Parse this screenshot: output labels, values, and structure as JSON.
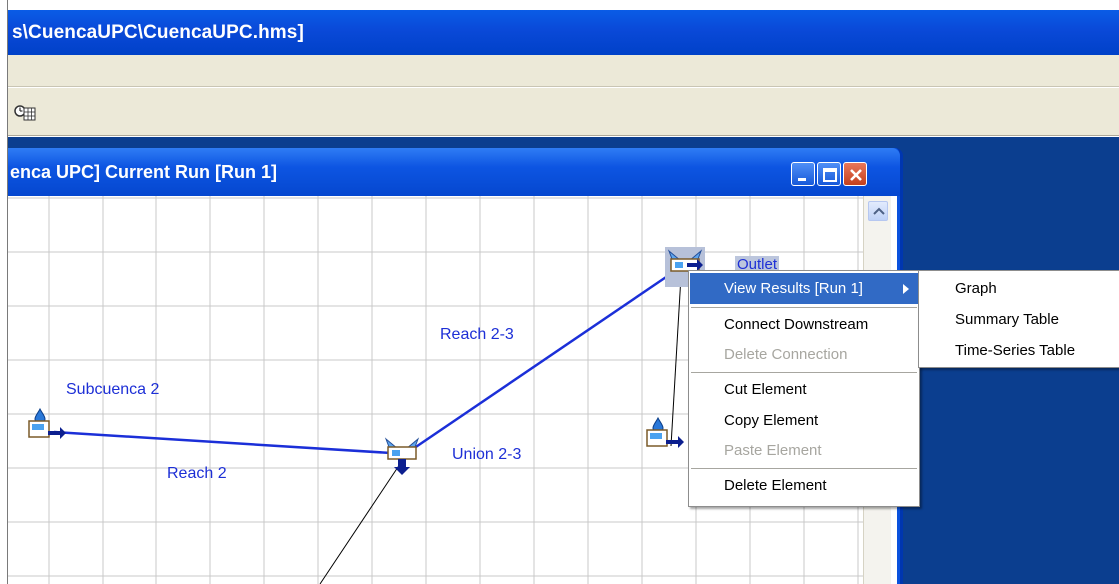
{
  "app": {
    "title": "s\\CuencaUPC\\CuencaUPC.hms]"
  },
  "child_window": {
    "title": "enca UPC]  Current Run [Run 1]"
  },
  "canvas": {
    "labels": {
      "subcuenca2": "Subcuenca 2",
      "reach2": "Reach 2",
      "reach23": "Reach 2-3",
      "union23": "Union 2-3",
      "outlet": "Outlet"
    }
  },
  "context_menu": {
    "items": [
      {
        "label": "View Results [Run 1]",
        "state": "highlighted",
        "has_submenu": true
      },
      {
        "label": "Connect Downstream",
        "state": "enabled"
      },
      {
        "label": "Delete Connection",
        "state": "disabled"
      },
      {
        "label": "Cut Element",
        "state": "enabled"
      },
      {
        "label": "Copy Element",
        "state": "enabled"
      },
      {
        "label": "Paste Element",
        "state": "disabled"
      },
      {
        "label": "Delete Element",
        "state": "enabled"
      }
    ]
  },
  "submenu": {
    "items": [
      {
        "label": "Graph"
      },
      {
        "label": "Summary Table"
      },
      {
        "label": "Time-Series Table"
      }
    ]
  },
  "colors": {
    "titlebar_blue": "#0a49d8",
    "menu_highlight": "#316ac5",
    "canvas_text": "#1d2fd6",
    "workspace": "#0b3e8f"
  },
  "icons": [
    "toolbar-calendar-icon",
    "minimize-icon",
    "maximize-icon",
    "close-icon",
    "scroll-up-icon",
    "subbasin-icon",
    "junction-icon",
    "submenu-arrow-icon"
  ]
}
